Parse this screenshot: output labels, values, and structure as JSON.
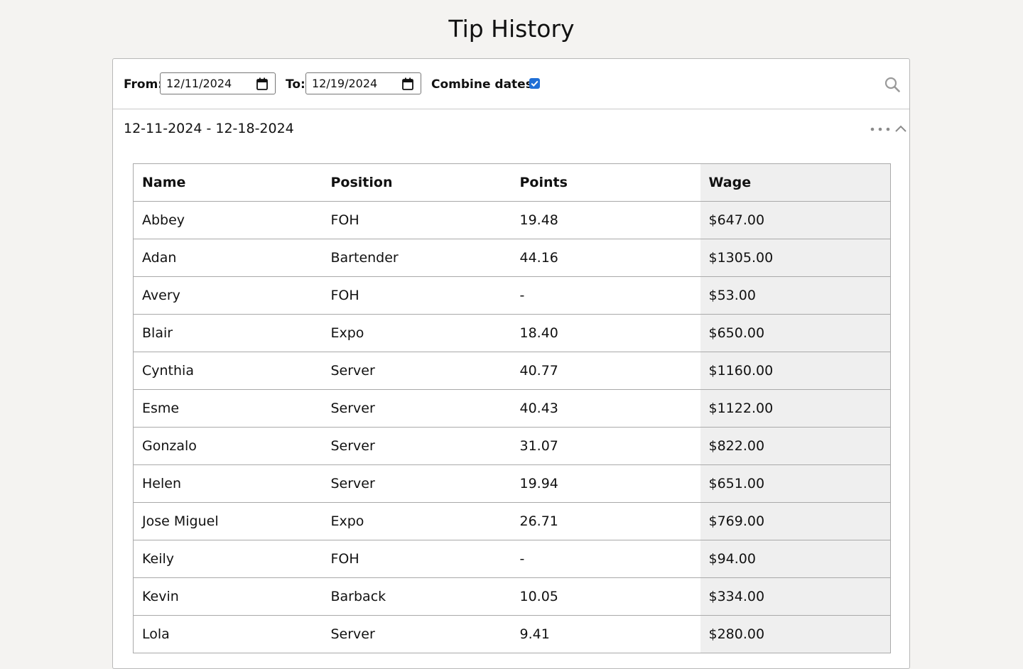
{
  "page": {
    "title": "Tip History"
  },
  "filters": {
    "from_label": "From:",
    "from_value": "12/11/2024",
    "to_label": "To:",
    "to_value": "12/19/2024",
    "combine_label": "Combine dates?",
    "combine_checked": true,
    "search_icon": "search-icon"
  },
  "period": {
    "label": "12-11-2024 - 12-18-2024",
    "more_icon": "more-horizontal-icon",
    "collapse_icon": "chevron-up-icon"
  },
  "table": {
    "columns": [
      "Name",
      "Position",
      "Points",
      "Wage"
    ],
    "rows": [
      [
        "Abbey",
        "FOH",
        "19.48",
        "$647.00"
      ],
      [
        "Adan",
        "Bartender",
        "44.16",
        "$1305.00"
      ],
      [
        "Avery",
        "FOH",
        "-",
        "$53.00"
      ],
      [
        "Blair",
        "Expo",
        "18.40",
        "$650.00"
      ],
      [
        "Cynthia",
        "Server",
        "40.77",
        "$1160.00"
      ],
      [
        "Esme",
        "Server",
        "40.43",
        "$1122.00"
      ],
      [
        "Gonzalo",
        "Server",
        "31.07",
        "$822.00"
      ],
      [
        "Helen",
        "Server",
        "19.94",
        "$651.00"
      ],
      [
        "Jose Miguel",
        "Expo",
        "26.71",
        "$769.00"
      ],
      [
        "Keily",
        "FOH",
        "-",
        "$94.00"
      ],
      [
        "Kevin",
        "Barback",
        "10.05",
        "$334.00"
      ],
      [
        "Lola",
        "Server",
        "9.41",
        "$280.00"
      ]
    ]
  },
  "colors": {
    "background": "#f4f3f1",
    "checkbox": "#1f6fd6",
    "wage_column_bg": "#efefef",
    "border": "#a9a9a9"
  }
}
